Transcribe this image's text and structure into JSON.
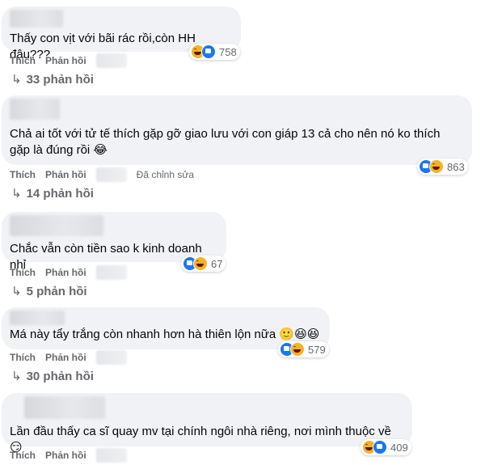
{
  "comments": [
    {
      "text": "Thấy con vịt với bãi rác rồi,còn HH đâu???",
      "actions": {
        "like": "Thích",
        "reply": "Phản hồi"
      },
      "reaction_icons": [
        "haha-icon",
        "like-icon"
      ],
      "reaction_count": "758",
      "replies_label": "33 phản hồi",
      "replies_arrow": "↳"
    },
    {
      "text": "Chả ai tốt với tử tế thích gặp gỡ giao lưu với con giáp 13 cả cho nên nó ko thích gặp là đúng rồi 😂",
      "actions": {
        "like": "Thích",
        "reply": "Phản hồi",
        "edited": "Đã chỉnh sửa"
      },
      "reaction_icons": [
        "like-icon",
        "haha-icon"
      ],
      "reaction_count": "863",
      "replies_label": "14 phản hồi",
      "replies_arrow": "↳"
    },
    {
      "text": "Chắc vẫn còn tiền sao k kinh doanh nhỉ",
      "actions": {
        "like": "Thích",
        "reply": "Phản hồi"
      },
      "reaction_icons": [
        "like-icon",
        "haha-icon"
      ],
      "reaction_count": "67",
      "replies_label": "5 phản hồi",
      "replies_arrow": "↳"
    },
    {
      "text": "Má này tẩy trắng còn nhanh hơn hà thiên lộn nữa 🙂😆😆",
      "actions": {
        "like": "Thích",
        "reply": "Phản hồi"
      },
      "reaction_icons": [
        "like-icon",
        "haha-icon"
      ],
      "reaction_count": "579",
      "replies_label": "30 phản hồi",
      "replies_arrow": "↳"
    },
    {
      "text": "Lần đầu thấy ca sĩ quay mv tại chính ngôi nhà riêng, nơi mình thuộc về 😏",
      "actions": {
        "like": "Thích",
        "reply": "Phản hồi"
      },
      "reaction_icons": [
        "haha-icon",
        "like-icon"
      ],
      "reaction_count": "409"
    }
  ],
  "colors": {
    "bubble": "#f0f2f5",
    "meta_text": "#65676b",
    "like_blue": "#1877f2",
    "haha_yellow": "#f7b125"
  }
}
